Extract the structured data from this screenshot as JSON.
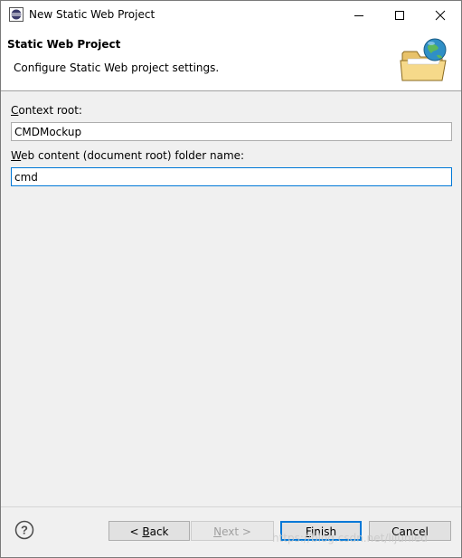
{
  "window": {
    "title": "New Static Web Project",
    "controls": {
      "minimize": "minimize",
      "maximize": "maximize",
      "close": "close"
    }
  },
  "banner": {
    "title": "Static Web Project",
    "description": "Configure Static Web project settings.",
    "icon": "globe-folder-icon"
  },
  "form": {
    "context_root": {
      "label_mnemonic": "C",
      "label_rest": "ontext root:",
      "value": "CMDMockup"
    },
    "web_content": {
      "label_mnemonic": "W",
      "label_rest": "eb content (document root) folder name:",
      "value": "cmd"
    }
  },
  "buttons": {
    "back": {
      "pre": "< ",
      "mnemonic": "B",
      "rest": "ack"
    },
    "next": {
      "mnemonic": "N",
      "rest": "ext >"
    },
    "finish": {
      "mnemonic": "F",
      "rest": "inish"
    },
    "cancel": "Cancel"
  },
  "watermark": "https://blog.csdn.net/lijunled",
  "colors": {
    "accent": "#0078d7",
    "border": "#adadad"
  }
}
